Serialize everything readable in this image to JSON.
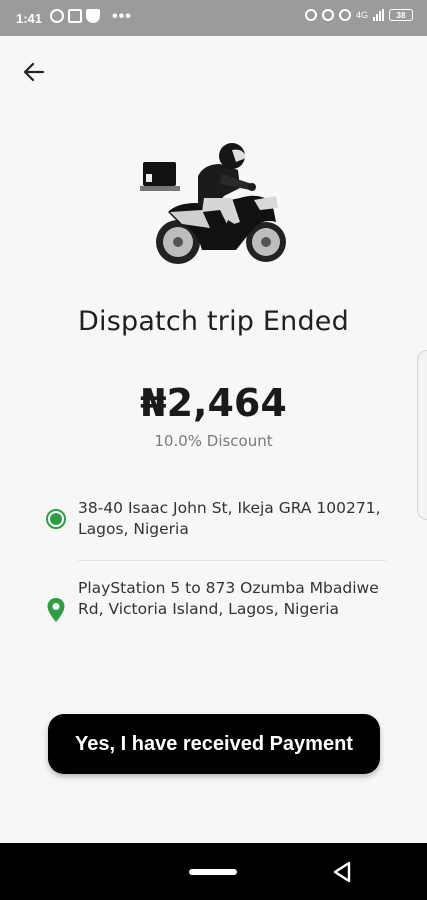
{
  "status_bar": {
    "time": "1:41",
    "battery": "38",
    "network_label": "4G"
  },
  "header": {
    "back_icon": "arrow-left-icon"
  },
  "trip": {
    "title": "Dispatch trip Ended",
    "fare": "₦2,464",
    "discount": "10.0% Discount"
  },
  "route": {
    "pickup": {
      "icon": "pickup-dot-icon",
      "address": "38-40 Isaac John St, Ikeja GRA 100271, Lagos, Nigeria"
    },
    "dropoff": {
      "icon": "location-pin-icon",
      "address": "PlayStation 5 to 873 Ozumba Mbadiwe Rd, Victoria Island, Lagos, Nigeria"
    }
  },
  "actions": {
    "confirm_payment_label": "Yes, I have received Payment"
  },
  "colors": {
    "accent_green": "#2e9e45",
    "button_bg": "#000000",
    "background": "#f7f7f7"
  }
}
